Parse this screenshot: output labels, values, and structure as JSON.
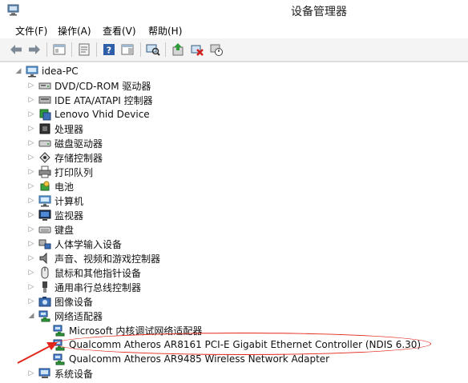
{
  "window": {
    "title": "设备管理器"
  },
  "menu": [
    "文件(F)",
    "操作(A)",
    "查看(V)",
    "帮助(H)"
  ],
  "toolbar": {
    "icons": [
      "back-arrow-icon",
      "forward-arrow-icon",
      "show-hide-tree-icon",
      "properties-icon",
      "help-icon",
      "action-pane-icon",
      "scan-hardware-icon",
      "update-driver-icon",
      "uninstall-device-icon",
      "disable-device-icon"
    ]
  },
  "tree": {
    "root": {
      "label": "idea-PC",
      "icon": "computer-icon"
    },
    "categories": [
      {
        "label": "DVD/CD-ROM 驱动器",
        "icon": "optical-drive-icon",
        "expanded": false
      },
      {
        "label": "IDE ATA/ATAPI 控制器",
        "icon": "ide-controller-icon",
        "expanded": false
      },
      {
        "label": "Lenovo Vhid Device",
        "icon": "hid-device-icon",
        "expanded": false
      },
      {
        "label": "处理器",
        "icon": "processor-icon",
        "expanded": false
      },
      {
        "label": "磁盘驱动器",
        "icon": "disk-drive-icon",
        "expanded": false
      },
      {
        "label": "存储控制器",
        "icon": "storage-controller-icon",
        "expanded": false
      },
      {
        "label": "打印队列",
        "icon": "printer-icon",
        "expanded": false
      },
      {
        "label": "电池",
        "icon": "battery-icon",
        "expanded": false
      },
      {
        "label": "计算机",
        "icon": "computer-icon",
        "expanded": false
      },
      {
        "label": "监视器",
        "icon": "monitor-icon",
        "expanded": false
      },
      {
        "label": "键盘",
        "icon": "keyboard-icon",
        "expanded": false
      },
      {
        "label": "人体学输入设备",
        "icon": "hid-icon",
        "expanded": false
      },
      {
        "label": "声音、视频和游戏控制器",
        "icon": "sound-icon",
        "expanded": false
      },
      {
        "label": "鼠标和其他指针设备",
        "icon": "mouse-icon",
        "expanded": false
      },
      {
        "label": "通用串行总线控制器",
        "icon": "usb-icon",
        "expanded": false
      },
      {
        "label": "图像设备",
        "icon": "imaging-device-icon",
        "expanded": false
      },
      {
        "label": "网络适配器",
        "icon": "network-adapter-icon",
        "expanded": true,
        "children": [
          {
            "label": "Microsoft 内核调试网络适配器",
            "icon": "network-adapter-icon"
          },
          {
            "label": "Qualcomm Atheros AR8161 PCI-E Gigabit Ethernet Controller (NDIS 6.30)",
            "icon": "network-adapter-icon",
            "highlighted": true
          },
          {
            "label": "Qualcomm Atheros AR9485 Wireless Network Adapter",
            "icon": "network-adapter-icon"
          }
        ]
      },
      {
        "label": "系统设备",
        "icon": "system-device-icon",
        "expanded": false
      }
    ]
  },
  "colors": {
    "annotation": "#e3261b",
    "toolbar_bg": "#f4f4f4",
    "expander": "#8a8a8a"
  }
}
